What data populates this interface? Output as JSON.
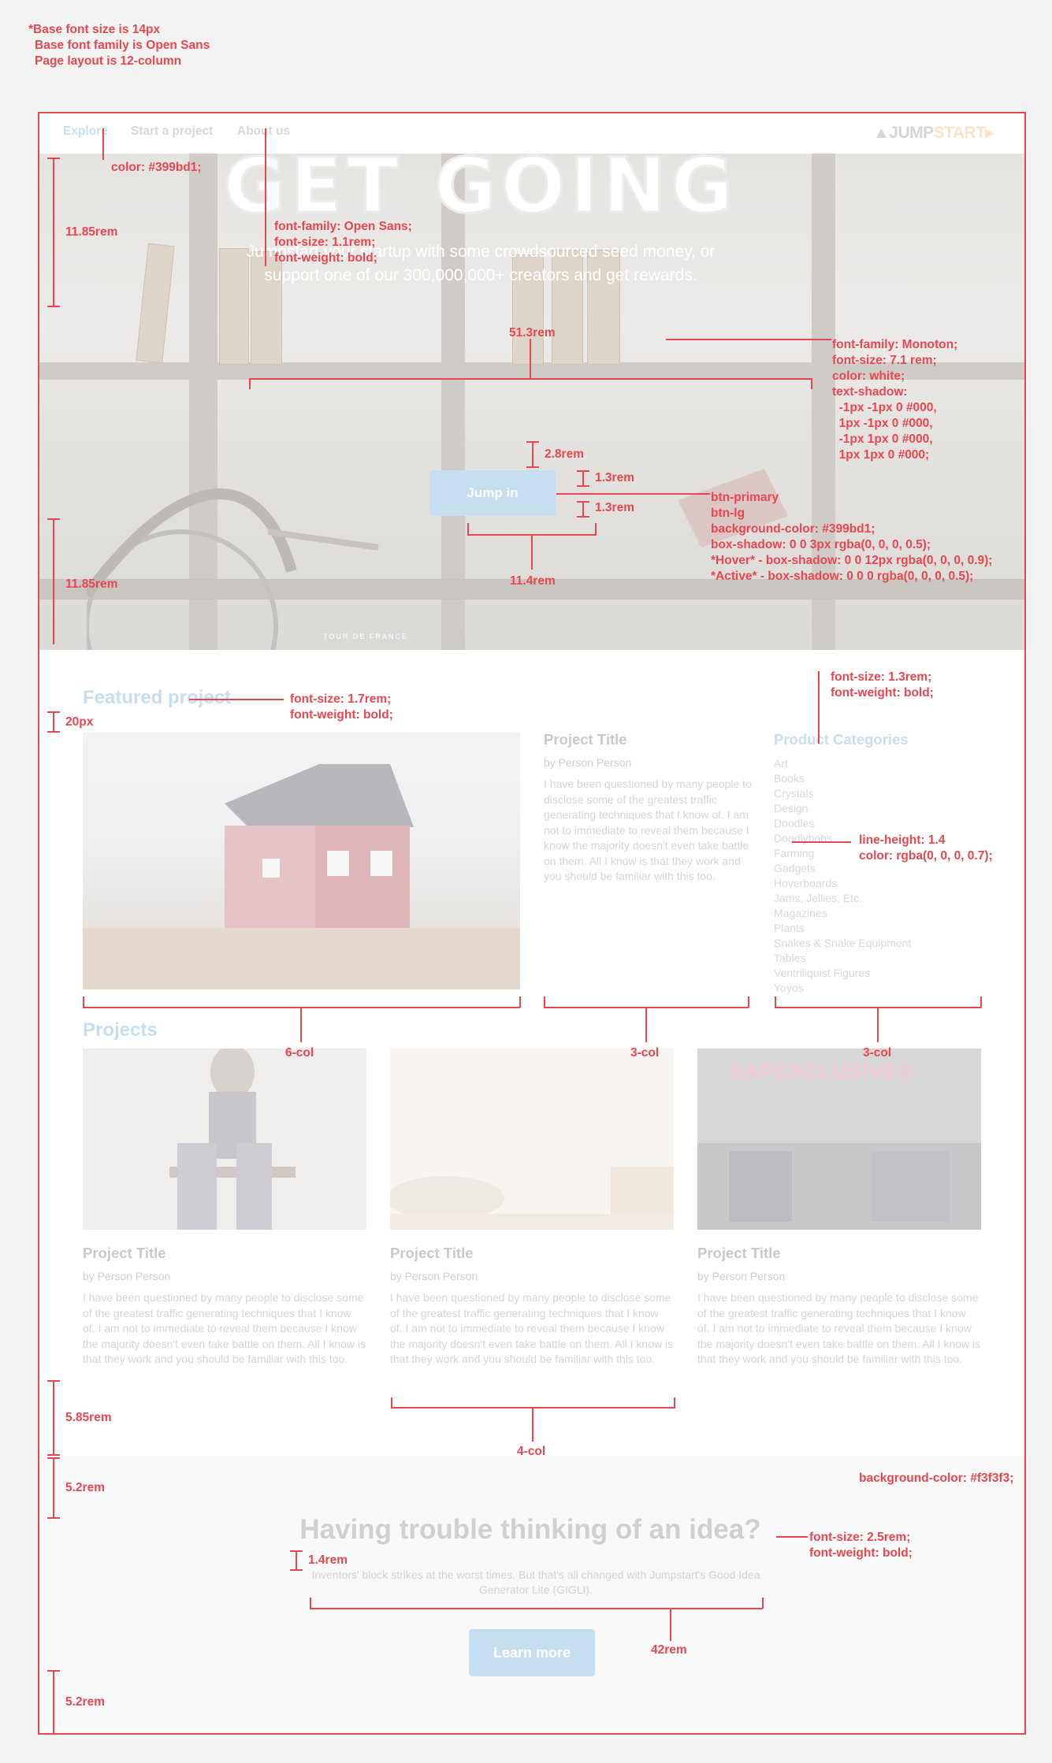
{
  "base_notes": [
    "*Base font size is 14px",
    "Base font family is Open Sans",
    "Page layout is 12-column"
  ],
  "nav": {
    "items": [
      "Explore",
      "Start a project",
      "About us"
    ],
    "logo_a": "JUMP",
    "logo_b": "START"
  },
  "hero": {
    "title": "GET GOING",
    "subtitle_1": "Jumpstart your startup with some crowdsourced seed money, or",
    "subtitle_2": "support one of our 300,000,000+ creators and get rewards.",
    "button": "Jump in",
    "small_print": "TOUR DE FRANCE"
  },
  "featured": {
    "heading": "Featured project",
    "title": "Project Title",
    "by": "by Person Person",
    "desc": "I have been questioned by many people to disclose some of the greatest traffic generating techniques that I know of. I am not to immediate to reveal them because I know the majority doesn't even take battle on them. All I know is that they work and you should be familiar with this too."
  },
  "categories": {
    "heading": "Product Categories",
    "items": [
      "Art",
      "Books",
      "Crystals",
      "Design",
      "Doodles",
      "Doodlybobs",
      "Farming",
      "Gadgets",
      "Hoverboards",
      "Jams, Jellies, Etc.",
      "Magazines",
      "Plants",
      "Snakes & Snake Equipment",
      "Tables",
      "Ventriliquist Figures",
      "Yoyos"
    ]
  },
  "projects": {
    "heading": "Projects",
    "items": [
      {
        "title": "Project Title",
        "by": "by Person Person",
        "desc": "I have been questioned by many people to disclose some of the greatest traffic generating techniques that I know of. I am not to immediate to reveal them because I know the majority doesn't even take battle on them. All I know is that they work and you should be familiar with this too."
      },
      {
        "title": "Project Title",
        "by": "by Person Person",
        "desc": "I have been questioned by many people to disclose some of the greatest traffic generating techniques that I know of. I am not to immediate to reveal them because I know the majority doesn't even take battle on them. All I know is that they work and you should be familiar with this too."
      },
      {
        "title": "Project Title",
        "by": "by Person Person",
        "desc": "I have been questioned by many people to disclose some of the greatest traffic generating techniques that I know of. I am not to immediate to reveal them because I know the majority doesn't even take battle on them. All I know is that they work and you should be familiar with this too."
      }
    ],
    "neon_sign": "BAPEXCLUSIVE®"
  },
  "footer": {
    "title": "Having trouble thinking of an idea?",
    "text": "Inventors' block strikes at the worst times. But that's all changed with Jumpstart's Good Idea Generator Lite (GIGLI).",
    "button": "Learn more"
  },
  "annotations": {
    "nav_color": "color: #399bd1;",
    "nav_font": "font-family: Open Sans;\nfont-size: 1.1rem;\nfont-weight: bold;",
    "hero_top": "11.85rem",
    "hero_bottom": "11.85rem",
    "title_width": "51.3rem",
    "title_font": "font-family: Monoton;\nfont-size: 7.1 rem;\ncolor: white;\ntext-shadow:\n  -1px -1px 0 #000,\n  1px -1px 0 #000,\n  -1px 1px 0 #000,\n  1px 1px 0 #000;",
    "gap_2_8": "2.8rem",
    "pad_top": "1.3rem",
    "pad_bottom": "1.3rem",
    "btn_spec": "btn-primary\nbtn-lg\nbackground-color: #399bd1;\nbox-shadow: 0 0 3px rgba(0, 0, 0, 0.5);\n*Hover* - box-shadow: 0 0 12px rgba(0, 0, 0, 0.9);\n*Active* - box-shadow: 0 0 0 rgba(0, 0, 0, 0.5);",
    "btn_width": "11.4rem",
    "featured_font": "font-size: 1.7rem;\nfont-weight: bold;",
    "gap_20px": "20px",
    "cat_heading_font": "font-size: 1.3rem;\nfont-weight: bold;",
    "cat_line": "line-height: 1.4\ncolor: rgba(0, 0, 0, 0.7);",
    "col6": "6-col",
    "col3a": "3-col",
    "col3b": "3-col",
    "col4": "4-col",
    "gap_5_85": "5.85rem",
    "gap_5_2a": "5.2rem",
    "gap_5_2b": "5.2rem",
    "footer_bg": "background-color: #f3f3f3;",
    "footer_title_font": "font-size: 2.5rem;\nfont-weight: bold;",
    "gap_1_4": "1.4rem",
    "width_42": "42rem"
  }
}
